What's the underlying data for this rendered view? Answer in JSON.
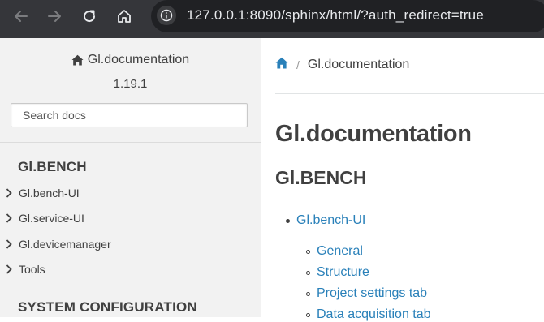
{
  "browser": {
    "url_host": "127.0.0.1",
    "url_rest": ":8090/sphinx/html/?auth_redirect=true"
  },
  "sidebar": {
    "brand": "Gl.documentation",
    "version": "1.19.1",
    "search_placeholder": "Search docs",
    "captions": [
      "Gl.BENCH",
      "SYSTEM CONFIGURATION"
    ],
    "items": [
      {
        "label": "Gl.bench-UI"
      },
      {
        "label": "Gl.service-UI"
      },
      {
        "label": "Gl.devicemanager"
      },
      {
        "label": "Tools"
      }
    ]
  },
  "main": {
    "breadcrumb_current": "Gl.documentation",
    "title": "Gl.documentation",
    "section_title": "Gl.BENCH",
    "toc_top": "Gl.bench-UI",
    "toc_sub": [
      "General",
      "Structure",
      "Project settings tab",
      "Data acquisition tab"
    ]
  },
  "colors": {
    "link": "#2980b9",
    "text": "#404040",
    "sidebar_bg": "#f2f2f2",
    "chrome_bg": "#35363a"
  }
}
